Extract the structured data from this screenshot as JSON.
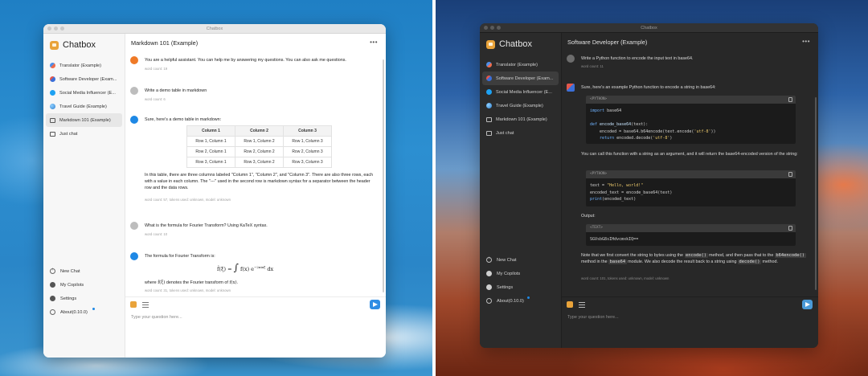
{
  "brand": {
    "name": "Chatbox",
    "window_title": "Chatbox"
  },
  "sessions": [
    {
      "label": "Translator (Example)",
      "icon": "translator-icon"
    },
    {
      "label": "Software Developer (Exam...",
      "icon": "developer-icon"
    },
    {
      "label": "Social Media Influencer (E...",
      "icon": "twitter-icon"
    },
    {
      "label": "Travel Guide (Example)",
      "icon": "globe-icon"
    },
    {
      "label": "Markdown 101 (Example)",
      "icon": "chat-icon"
    },
    {
      "label": "Just chat",
      "icon": "chat-icon"
    }
  ],
  "sidebar_bottom": {
    "new_chat": "New Chat",
    "copilots": "My Copilots",
    "settings": "Settings",
    "about": "About(0.10.0)"
  },
  "input": {
    "placeholder": "Type your question here..."
  },
  "light": {
    "header": "Markdown 101 (Example)",
    "messages": {
      "system_text": "You are a helpful assistant. You can help me by answering my questions. You can also ask me questions.",
      "system_wc": "word count: 19",
      "user1_text": "Write a demo table in markdown",
      "user1_wc": "word count: 6",
      "bot1_text": "Sure, here's a demo table in markdown:",
      "bot1_after": "In this table, there are three columns labeled \"Column 1\", \"Column 2\", and \"Column 3\". There are also three rows, each with a value in each column. The \"---\" used in the second row is markdown syntax for a separator between the header row and the data rows.",
      "bot1_wc": "word count: 57, tokens used: unknown, model: unknown",
      "user2_text": "What is the formula for Fourier Transform? Using KaTeX syntax.",
      "user2_wc": "word count: 10",
      "bot2_text": "The formula for Fourier Transform is:",
      "bot2_where_pre": "where",
      "bot2_where_mid": "denotes the Fourier transform of",
      "bot2_wc": "word count: 31, tokens used: unknown, model: unknown"
    },
    "table": {
      "headers": [
        "Column 1",
        "Column 2",
        "Column 3"
      ],
      "rows": [
        [
          "Row 1, Column 1",
          "Row 1, Column 2",
          "Row 1, Column 3"
        ],
        [
          "Row 2, Column 1",
          "Row 2, Column 2",
          "Row 2, Column 3"
        ],
        [
          "Row 3, Column 1",
          "Row 3, Column 2",
          "Row 3, Column 3"
        ]
      ]
    }
  },
  "dark": {
    "header": "Software Developer (Example)",
    "messages": {
      "user_text": "Write a Python function to encode the input text in base64.",
      "user_wc": "word count: 11",
      "bot_intro": "Sure, here's an example Python function to encode a string in base64:",
      "bot_mid": "You can call this function with a string as an argument, and it will return the base64-encoded version of the string:",
      "output_label": "Output:",
      "note_1": "Note that we first convert the string to bytes using the",
      "note_code1": "encode()",
      "note_2": "method, and then pass that to the",
      "note_code2": "b64encode()",
      "note_3": "method in the",
      "note_code3": "base64",
      "note_4": "module. We also decode the result back to a string using",
      "note_code4": "decode()",
      "note_5": "method.",
      "bot_wc": "word count: 101, tokens used: unknown, model: unknown"
    },
    "code_blocks": {
      "lang_python": "<PYTHON>",
      "lang_text": "<TEXT>",
      "output_value": "SGVsbG8sIHdvcmxkIQ=="
    }
  },
  "colors": {
    "accent": "#1e88e5",
    "brand": "#e9a33a",
    "system_avatar": "#ef7a27"
  }
}
